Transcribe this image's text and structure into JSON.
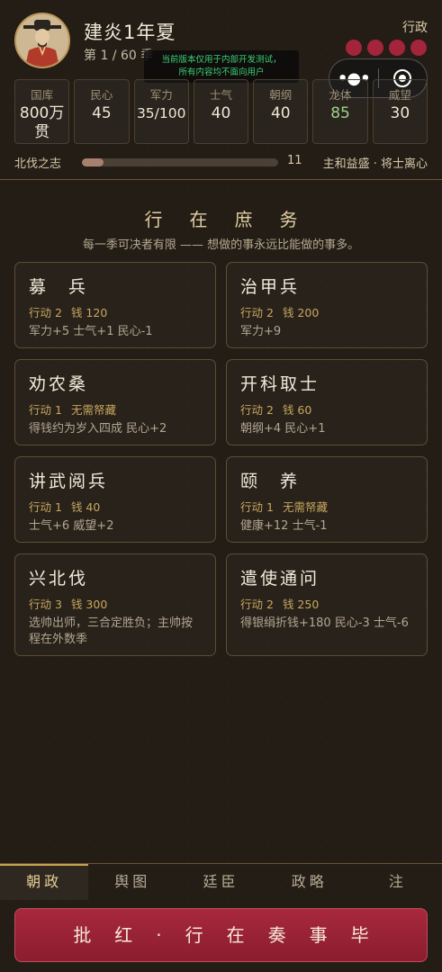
{
  "header": {
    "reign_title": "建炎1年夏",
    "season_count": "第 1 / 60 季",
    "action_label": "行政",
    "action_points": 4,
    "notice_line1": "当前版本仅用于内部开发测试，",
    "notice_line2": "所有内容均不面向用户",
    "capsule_more": "•●•"
  },
  "stats": [
    {
      "label": "国库",
      "value": "800万贯"
    },
    {
      "label": "民心",
      "value": "45"
    },
    {
      "label": "军力",
      "value": "35/100"
    },
    {
      "label": "士气",
      "value": "40"
    },
    {
      "label": "朝纲",
      "value": "40"
    },
    {
      "label": "龙体",
      "value": "85"
    },
    {
      "label": "威望",
      "value": "30"
    }
  ],
  "ambition": {
    "label": "北伐之志",
    "value": "11",
    "progress": 0.11,
    "status": "主和益盛 · 将士离心"
  },
  "section": {
    "title": "行在庶务",
    "subtitle": "每一季可决者有限 —— 想做的事永远比能做的事多。"
  },
  "tasks": [
    {
      "name": "募　兵",
      "action": "行动 2",
      "cost": "钱 120",
      "effect": "军力+5 士气+1 民心-1"
    },
    {
      "name": "治甲兵",
      "action": "行动 2",
      "cost": "钱 200",
      "effect": "军力+9"
    },
    {
      "name": "劝农桑",
      "action": "行动 1",
      "cost": "无需帑藏",
      "effect": "得钱约为岁入四成 民心+2"
    },
    {
      "name": "开科取士",
      "action": "行动 2",
      "cost": "钱 60",
      "effect": "朝纲+4 民心+1"
    },
    {
      "name": "讲武阅兵",
      "action": "行动 1",
      "cost": "钱 40",
      "effect": "士气+6 威望+2"
    },
    {
      "name": "颐　养",
      "action": "行动 1",
      "cost": "无需帑藏",
      "effect": "健康+12 士气-1"
    },
    {
      "name": "兴北伐",
      "action": "行动 3",
      "cost": "钱 300",
      "effect": "选帅出师，三合定胜负；主帅按程在外数季"
    },
    {
      "name": "遣使通问",
      "action": "行动 2",
      "cost": "钱 250",
      "effect": "得银绢折钱+180 民心-3 士气-6"
    }
  ],
  "tabs": [
    "朝政",
    "舆图",
    "廷臣",
    "政略",
    "注"
  ],
  "submit_label": "批红·行在奏事毕",
  "colors": {
    "accent": "#c8a34e",
    "danger": "#a3243b",
    "positive": "#9fd18a"
  }
}
